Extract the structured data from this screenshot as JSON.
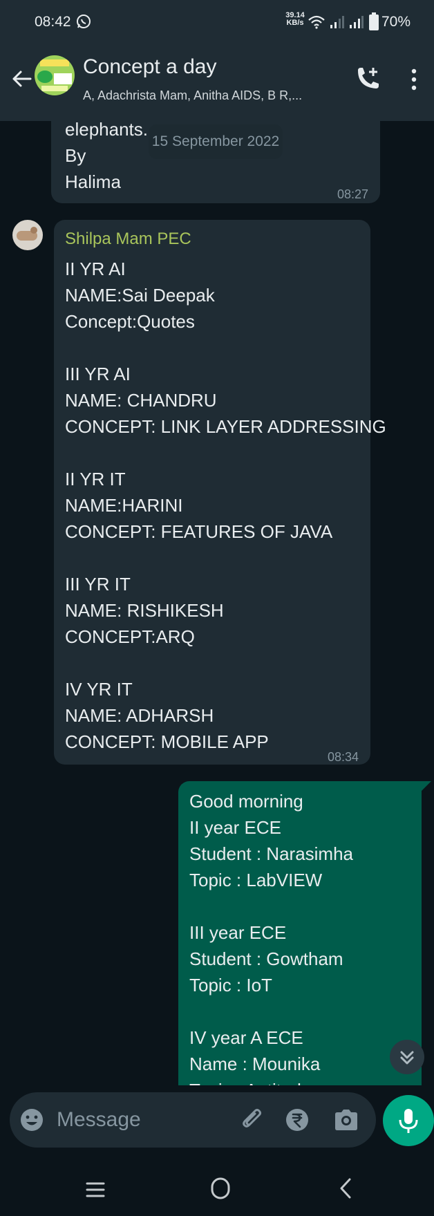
{
  "status_bar": {
    "time": "08:42",
    "speed_value": "39.14",
    "speed_unit": "KB/s",
    "battery": "70%"
  },
  "header": {
    "title": "Concept a day",
    "subtitle": "A, Adachrista Mam, Anitha AIDS, B R,..."
  },
  "date_chip": "15 September 2022",
  "messages": [
    {
      "direction": "incoming",
      "lines": [
        "elephants.",
        "By",
        "Halima"
      ],
      "time": "08:27"
    },
    {
      "direction": "incoming",
      "sender": "Shilpa Mam PEC",
      "sender_color": "#a9c55b",
      "lines": [
        "II YR AI",
        "NAME:Sai Deepak",
        "Concept:Quotes",
        "",
        "III YR AI",
        "NAME: CHANDRU",
        "CONCEPT: LINK LAYER ADDRESSING",
        "",
        "II YR IT",
        "NAME:HARINI",
        "CONCEPT: FEATURES OF JAVA",
        "",
        "III YR IT",
        "NAME: RISHIKESH",
        "CONCEPT:ARQ",
        "",
        "IV YR IT",
        "NAME: ADHARSH",
        "CONCEPT: MOBILE APP"
      ],
      "time": "08:34"
    },
    {
      "direction": "outgoing",
      "lines": [
        "Good morning",
        "II year ECE",
        "Student : Narasimha",
        "Topic : LabVIEW",
        "",
        "III year ECE",
        "Student : Gowtham",
        "Topic : IoT",
        "",
        "IV year A ECE",
        "Name : Mounika",
        "Topic : Aptitude"
      ]
    }
  ],
  "composer": {
    "placeholder": "Message"
  },
  "icons": {
    "back": "arrow-left-icon",
    "call": "add-call-icon",
    "menu": "more-vert-icon",
    "emoji": "emoji-icon",
    "attach": "paperclip-icon",
    "payment": "rupee-icon",
    "camera": "camera-icon",
    "mic": "mic-icon",
    "scroll": "double-chevron-down-icon"
  },
  "colors": {
    "background": "#0b141a",
    "header": "#1f2c34",
    "incoming_bubble": "#1f2c34",
    "outgoing_bubble": "#005c4b",
    "accent": "#00a884"
  }
}
